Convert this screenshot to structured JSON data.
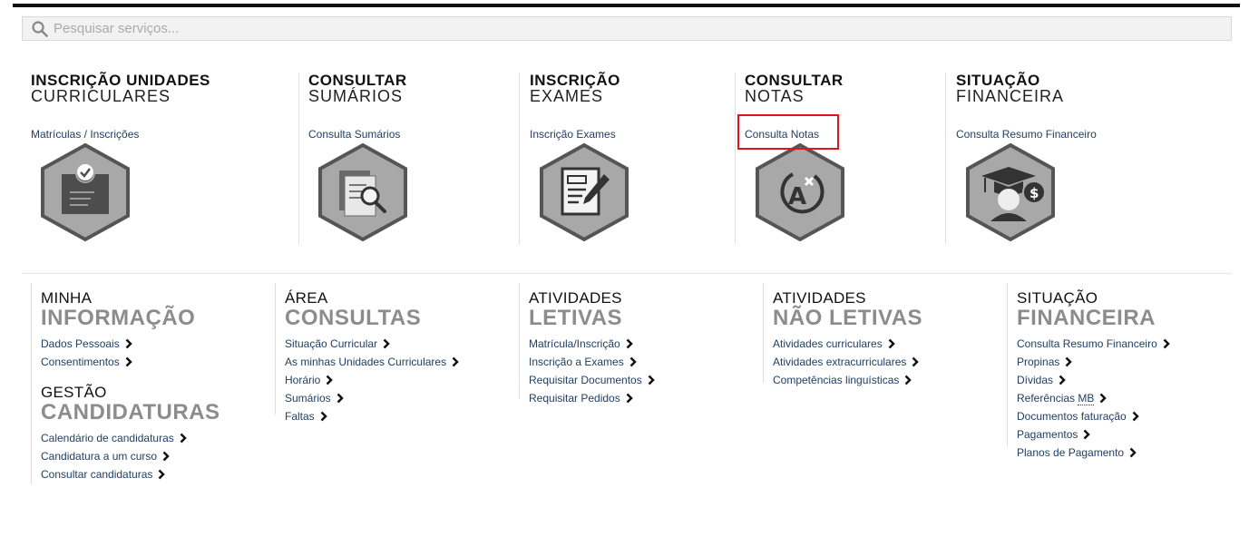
{
  "search": {
    "placeholder": "Pesquisar serviços..."
  },
  "quick_services": [
    {
      "title_line1": "INSCRIÇÃO UNIDADES",
      "title_line2": "CURRICULARES",
      "link": "Matrículas / Inscrições",
      "icon": "enrollment-icon"
    },
    {
      "title_line1": "CONSULTAR",
      "title_line2": "SUMÁRIOS",
      "link": "Consulta Sumários",
      "icon": "summaries-search-icon"
    },
    {
      "title_line1": "INSCRIÇÃO",
      "title_line2": "EXAMES",
      "link": "Inscrição Exames",
      "icon": "exam-signup-icon"
    },
    {
      "title_line1": "CONSULTAR",
      "title_line2": "NOTAS",
      "link": "Consulta Notas",
      "icon": "grades-icon"
    },
    {
      "title_line1": "SITUAÇÃO",
      "title_line2": "FINANCEIRA",
      "link": "Consulta Resumo Financeiro",
      "icon": "graduate-finance-icon"
    }
  ],
  "menu": {
    "minha_informacao": {
      "h1": "MINHA",
      "h2": "INFORMAÇÃO",
      "items": [
        "Dados Pessoais",
        "Consentimentos"
      ]
    },
    "gestao_candidaturas": {
      "h1": "GESTÃO",
      "h2": "CANDIDATURAS",
      "items": [
        "Calendário de candidaturas",
        "Candidatura a um curso",
        "Consultar candidaturas"
      ]
    },
    "area_consultas": {
      "h1": "ÁREA",
      "h2": "CONSULTAS",
      "items": [
        "Situação Curricular",
        "As minhas Unidades Curriculares",
        "Horário",
        "Sumários",
        "Faltas"
      ]
    },
    "atividades_letivas": {
      "h1": "ATIVIDADES",
      "h2": "LETIVAS",
      "items": [
        "Matrícula/Inscrição",
        "Inscrição a Exames",
        "Requisitar Documentos",
        "Requisitar Pedidos"
      ]
    },
    "atividades_nao_letivas": {
      "h1": "ATIVIDADES",
      "h2": "NÃO LETIVAS",
      "items": [
        "Atividades curriculares",
        "Atividades extracurriculares",
        "Competências linguísticas"
      ]
    },
    "situacao_financeira": {
      "h1": "SITUAÇÃO",
      "h2": "FINANCEIRA",
      "items": [
        "Consulta Resumo Financeiro",
        "Propinas",
        "Dívidas",
        "Referências",
        "Documentos faturação",
        "Pagamentos",
        "Planos de Pagamento"
      ],
      "referencias_abbr": "MB"
    }
  },
  "colors": {
    "link": "#1f3f63",
    "heading_grey": "#8c8c8c",
    "hex_fill": "#a8a8a8",
    "hex_border": "#555555",
    "highlight": "#e3131b"
  }
}
